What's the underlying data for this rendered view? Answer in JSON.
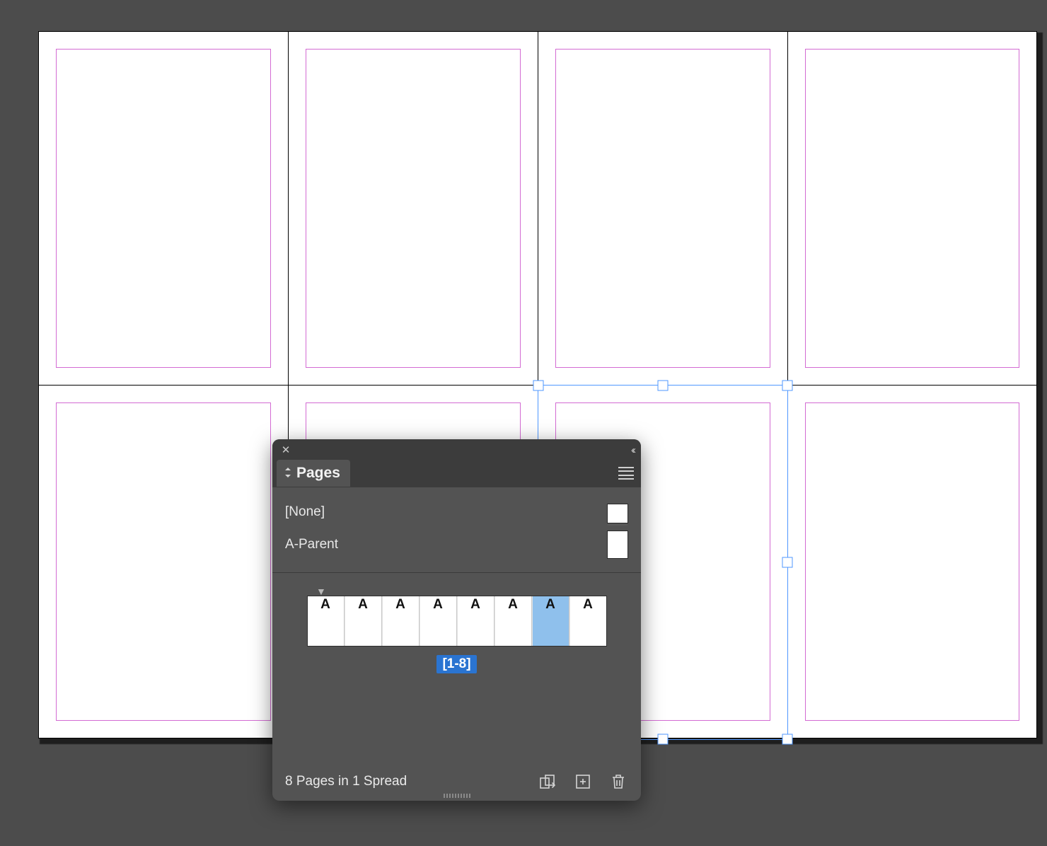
{
  "canvas": {
    "pages": [
      1,
      2,
      3,
      4,
      5,
      6,
      7,
      8
    ],
    "selected_frame_page": 7
  },
  "panel": {
    "title": "Pages",
    "masters": [
      {
        "label": "[None]",
        "type": "none"
      },
      {
        "label": "A-Parent",
        "type": "page"
      }
    ],
    "thumbs": [
      {
        "label": "A",
        "selected": false
      },
      {
        "label": "A",
        "selected": false
      },
      {
        "label": "A",
        "selected": false
      },
      {
        "label": "A",
        "selected": false
      },
      {
        "label": "A",
        "selected": false
      },
      {
        "label": "A",
        "selected": false
      },
      {
        "label": "A",
        "selected": true
      },
      {
        "label": "A",
        "selected": false
      }
    ],
    "range_label": "[1-8]",
    "status": "8 Pages in 1 Spread"
  }
}
